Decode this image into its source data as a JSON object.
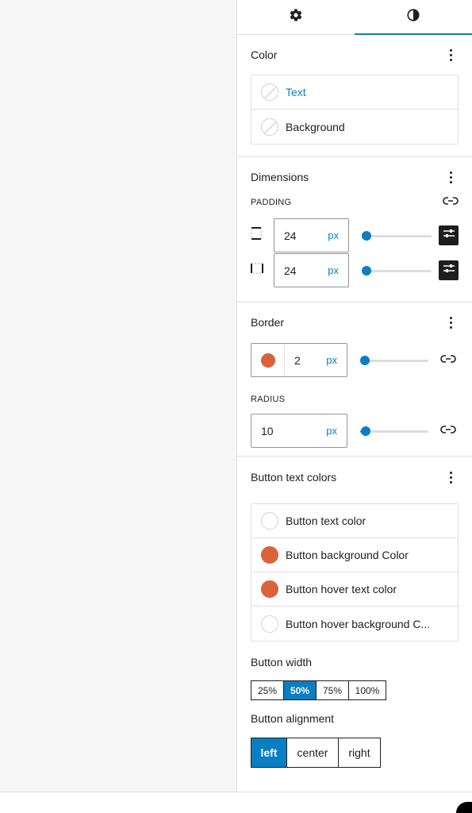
{
  "tabs": [
    {
      "icon": "gear-icon",
      "active": false
    },
    {
      "icon": "contrast-icon",
      "active": true
    }
  ],
  "color": {
    "title": "Color",
    "items": [
      {
        "label": "Text",
        "swatch": "none",
        "highlight": true
      },
      {
        "label": "Background",
        "swatch": "none",
        "highlight": false
      }
    ]
  },
  "dimensions": {
    "title": "Dimensions",
    "padding_label": "Padding",
    "rows": [
      {
        "value": "24",
        "unit": "px",
        "slider": 0.0
      },
      {
        "value": "24",
        "unit": "px",
        "slider": 0.0
      }
    ]
  },
  "border": {
    "title": "Border",
    "color": "#d9623b",
    "width_value": "2",
    "width_unit": "px",
    "width_slider": 0.0,
    "radius_label": "Radius",
    "radius_value": "10",
    "radius_unit": "px",
    "radius_slider": 0.02
  },
  "button_colors": {
    "title": "Button text colors",
    "items": [
      {
        "label": "Button text color",
        "color": "#ffffff"
      },
      {
        "label": "Button background Color",
        "color": "#d9623b"
      },
      {
        "label": "Button hover text color",
        "color": "#d9623b"
      },
      {
        "label": "Button hover background C...",
        "color": "#ffffff"
      }
    ]
  },
  "button_width": {
    "title": "Button width",
    "options": [
      "25%",
      "50%",
      "75%",
      "100%"
    ],
    "selected": "50%"
  },
  "button_alignment": {
    "title": "Button alignment",
    "options": [
      "left",
      "center",
      "right"
    ],
    "selected": "left"
  },
  "accent_color": "#0a7ec2"
}
